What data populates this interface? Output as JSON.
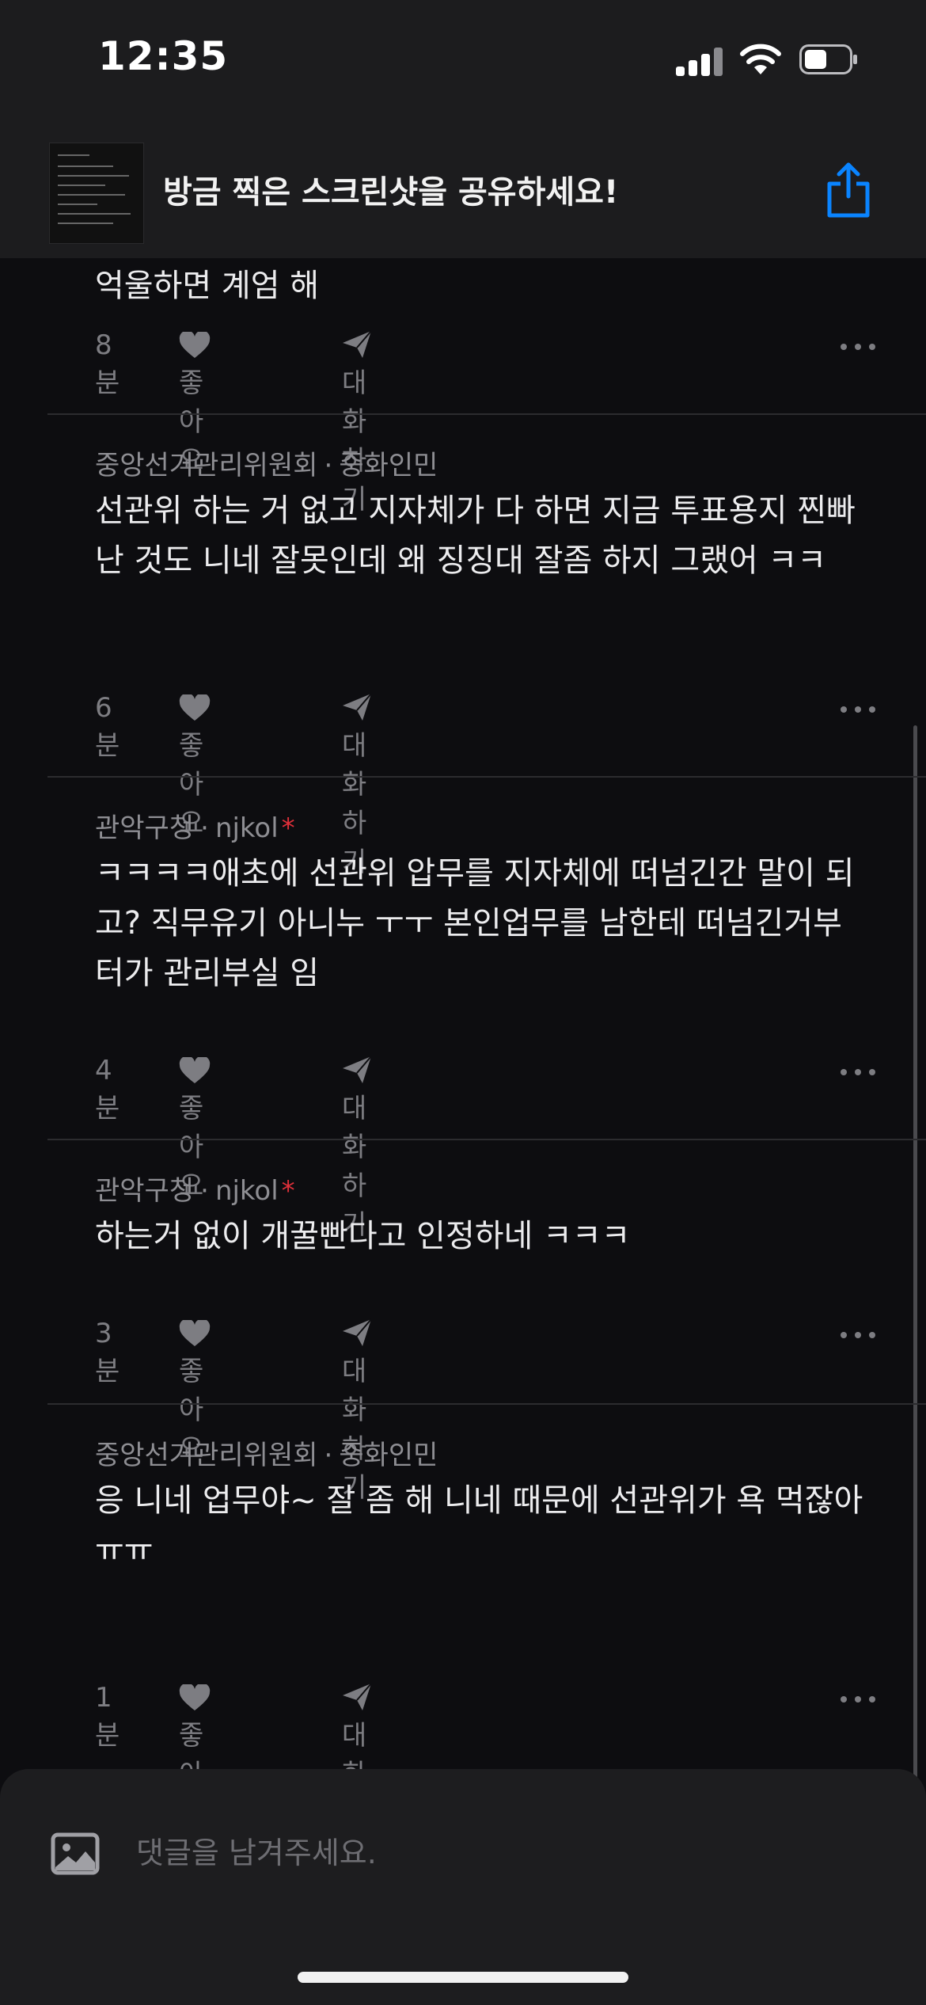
{
  "status": {
    "time": "12:35"
  },
  "banner": {
    "title": "방금 찍은 스크린샷을 공유하세요!"
  },
  "comments": [
    {
      "author": "",
      "tag": "",
      "body": "억울하면 계엄 해",
      "time": "8분",
      "like": "좋아요",
      "reply": "대화하기"
    },
    {
      "author": "중앙선거관리위원회",
      "tag": "중화인민",
      "body": "선관위 하는 거 없고 지자체가 다 하면 지금 투표용지 찐빠난 것도 니네 잘못인데 왜 징징대 잘좀 하지 그랬어 ㅋㅋ",
      "time": "6분",
      "like": "좋아요",
      "reply": "대화하기"
    },
    {
      "author": "관악구청",
      "tag": "njkol",
      "body": "ㅋㅋㅋㅋ애초에 선관위 압무를 지자체에 떠넘긴간 말이 되고? 직무유기 아니누 ㅜㅜ 본인업무를 남한테 떠넘긴거부터가 관리부실 임",
      "time": "4분",
      "like": "좋아요",
      "reply": "대화하기"
    },
    {
      "author": "관악구청",
      "tag": "njkol",
      "body": "하는거 없이 개꿀빤다고 인정하네 ㅋㅋㅋ",
      "time": "3분",
      "like": "좋아요",
      "reply": "대화하기"
    },
    {
      "author": "중앙선거관리위원회",
      "tag": "중화인민",
      "body": "응 니네 업무야~ 잘 좀 해 니네 때문에 선관위가 욕 먹잖아\nㅠㅠ",
      "time": "1분",
      "like": "좋아요",
      "reply": "대화하기"
    }
  ],
  "composer": {
    "placeholder": "댓글을 남겨주세요."
  },
  "colors": {
    "background": "#0d0d10",
    "panel": "#1c1c1e",
    "accent": "#0a84ff",
    "mention_star": "#e0303a"
  },
  "icons": [
    "signal-icon",
    "wifi-icon",
    "battery-icon",
    "share-icon",
    "heart-icon",
    "paper-plane-icon",
    "more-icon",
    "image-icon"
  ]
}
